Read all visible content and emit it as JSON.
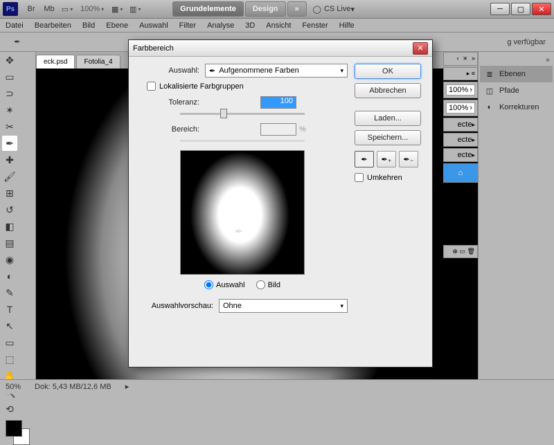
{
  "titlebar": {
    "logo": "Ps",
    "zoom": "100%",
    "workspace_active": "Grundelemente",
    "workspace_other": "Design",
    "more": "»",
    "cslive": "CS Live"
  },
  "menu": [
    "Datei",
    "Bearbeiten",
    "Bild",
    "Ebene",
    "Auswahl",
    "Filter",
    "Analyse",
    "3D",
    "Ansicht",
    "Fenster",
    "Hilfe"
  ],
  "optbar_tail": "g verfügbar",
  "tabs": {
    "active": "eck.psd",
    "other": "Fotolia_4"
  },
  "panels": {
    "ebenen": "Ebenen",
    "pfade": "Pfade",
    "korrekturen": "Korrekturen"
  },
  "midpanel": {
    "pct": "100%",
    "layertext": "ecte"
  },
  "status": {
    "zoom": "50%",
    "doc": "Dok: 5,43 MB/12,6 MB"
  },
  "dialog": {
    "title": "Farbbereich",
    "auswahl_label": "Auswahl:",
    "auswahl_value": "Aufgenommene Farben",
    "lokal": "Lokalisierte Farbgruppen",
    "toleranz_label": "Toleranz:",
    "toleranz_value": "100",
    "bereich_label": "Bereich:",
    "bereich_value": "",
    "bereich_unit": "%",
    "radio_auswahl": "Auswahl",
    "radio_bild": "Bild",
    "vorschau_label": "Auswahlvorschau:",
    "vorschau_value": "Ohne",
    "ok": "OK",
    "cancel": "Abbrechen",
    "load": "Laden...",
    "save": "Speichern...",
    "invert": "Umkehren"
  }
}
